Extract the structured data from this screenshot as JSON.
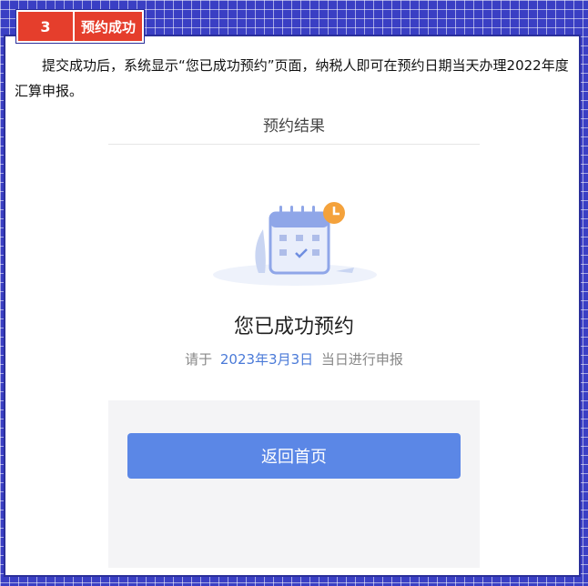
{
  "step": {
    "number": "3",
    "title": "预约成功"
  },
  "intro": "提交成功后，系统显示“您已成功预约”页面，纳税人即可在预约日期当天办理2022年度汇算申报。",
  "screen": {
    "header_title": "预约结果",
    "illustration_icon": "calendar-check-icon",
    "result_title": "您已成功预约",
    "result_prefix": "请于",
    "result_date": "2023年3月3日",
    "result_suffix": "当日进行申报",
    "home_button": "返回首页"
  },
  "colors": {
    "tag_red": "#e53e2c",
    "background_blue": "#3a3fc4",
    "button_blue": "#5b87e6",
    "date_blue": "#4a7ad8"
  }
}
